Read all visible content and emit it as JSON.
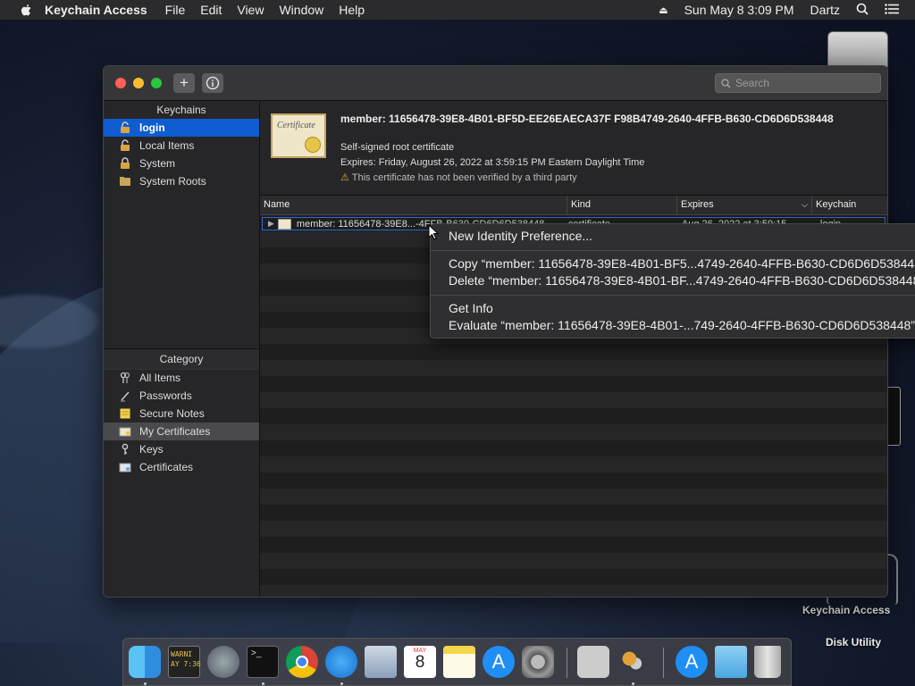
{
  "menubar": {
    "app_name": "Keychain Access",
    "menus": [
      "File",
      "Edit",
      "View",
      "Window",
      "Help"
    ],
    "clock": "Sun May 8  3:09 PM",
    "user": "Dartz"
  },
  "window": {
    "search_placeholder": "Search",
    "add_label": "+",
    "info_label": "i"
  },
  "sidebar": {
    "keychains_header": "Keychains",
    "keychains": [
      {
        "label": "login",
        "icon": "lock-open-icon"
      },
      {
        "label": "Local Items",
        "icon": "lock-open-icon"
      },
      {
        "label": "System",
        "icon": "lock-icon"
      },
      {
        "label": "System Roots",
        "icon": "folder-icon"
      }
    ],
    "category_header": "Category",
    "categories": [
      {
        "label": "All Items",
        "icon": "keys-icon"
      },
      {
        "label": "Passwords",
        "icon": "pencil-icon"
      },
      {
        "label": "Secure Notes",
        "icon": "note-icon"
      },
      {
        "label": "My Certificates",
        "icon": "certificate-icon"
      },
      {
        "label": "Keys",
        "icon": "key-icon"
      },
      {
        "label": "Certificates",
        "icon": "certificate-icon"
      }
    ]
  },
  "detail": {
    "title": "member: 11656478-39E8-4B01-BF5D-EE26EAECA37F F98B4749-2640-4FFB-B630-CD6D6D538448",
    "subtitle": "Self-signed root certificate",
    "expires": "Expires: Friday, August 26, 2022 at 3:59:15 PM Eastern Daylight Time",
    "warning": "This certificate has not been verified by a third party",
    "cert_image_text": "Certificate"
  },
  "table": {
    "columns": [
      "Name",
      "Kind",
      "Expires",
      "Keychain"
    ],
    "row": {
      "name": "member: 11656478-39E8...-4FFB-B630-CD6D6D538448",
      "kind": "certificate",
      "expires": "Aug 26, 2022 at 3:59:15",
      "keychain": "login"
    }
  },
  "context_menu": {
    "items": [
      "New Identity Preference...",
      "Copy “member: 11656478-39E8-4B01-BF5...4749-2640-4FFB-B630-CD6D6D538448”",
      "Delete “member: 11656478-39E8-4B01-BF...4749-2640-4FFB-B630-CD6D6D538448”",
      "Get Info",
      "Evaluate “member: 11656478-39E8-4B01-...749-2640-4FFB-B630-CD6D6D538448”"
    ]
  },
  "desktop": {
    "icon1_label": "Keychain Access",
    "icon2_label": "Disk Utility"
  },
  "dock": {
    "warning_tile": "WARNI\nAY 7:36",
    "calendar_month": "MAY",
    "calendar_day": "8",
    "apps": [
      "finder-icon",
      "console-icon",
      "launchpad-icon",
      "terminal-icon",
      "chrome-icon",
      "safari-icon",
      "preview-icon",
      "calendar-icon",
      "notes-icon",
      "app-store-icon",
      "system-preferences-icon",
      "accessibility-icon",
      "keychain-icon",
      "app-store-download-icon",
      "folder-icon",
      "trash-icon"
    ]
  },
  "colors": {
    "selection": "#0f5dd0",
    "traffic_red": "#ff5f57",
    "traffic_yellow": "#febc2e",
    "traffic_green": "#28c840"
  }
}
